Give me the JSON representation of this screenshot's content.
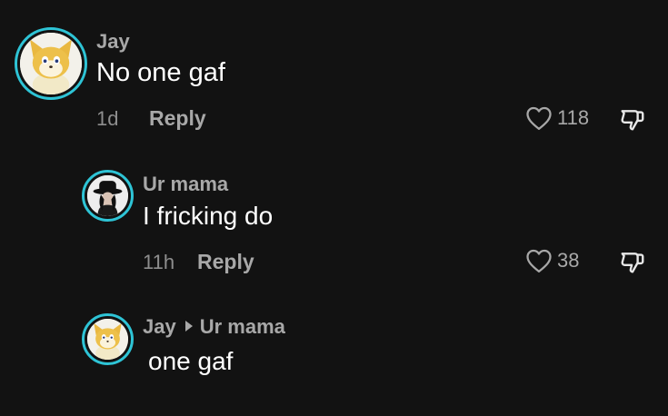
{
  "comments": [
    {
      "username": "Jay",
      "text": "No one gaf",
      "time": "1d",
      "reply_label": "Reply",
      "likes": "118"
    },
    {
      "username": "Ur mama",
      "text": "I fricking do",
      "time": "11h",
      "reply_label": "Reply",
      "likes": "38"
    },
    {
      "username": "Jay",
      "reply_to": "Ur mama",
      "text": "one gaf"
    }
  ],
  "icons": {
    "like": "heart-outline-icon",
    "dislike": "thumbs-down-outline-icon",
    "reply_to": "caret-right-icon"
  },
  "colors": {
    "background": "#121212",
    "avatar_ring": "#2ec4d6",
    "username": "#a8a8a8",
    "body_text": "#ffffff",
    "meta": "#8e8e8e"
  }
}
